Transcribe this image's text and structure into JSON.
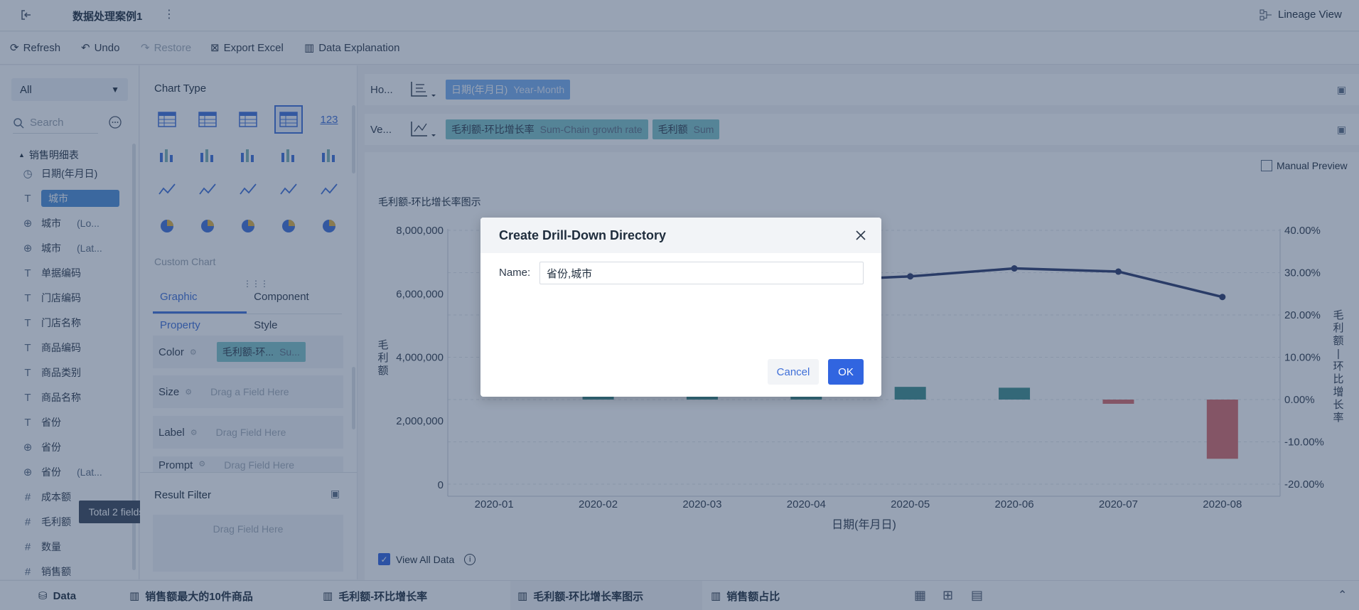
{
  "header": {
    "title": "数据处理案例1",
    "lineage_label": "Lineage View"
  },
  "toolbar": {
    "refresh": "Refresh",
    "undo": "Undo",
    "restore": "Restore",
    "export": "Export Excel",
    "explain": "Data Explanation"
  },
  "fields_panel": {
    "filter_value": "All",
    "search_placeholder": "Search",
    "table_name": "销售明细表",
    "fields": [
      {
        "icon": "clock-icon",
        "label": "日期(年月日)",
        "suffix": ""
      },
      {
        "icon": "text-icon",
        "label": "城市",
        "suffix": ""
      },
      {
        "icon": "globe-icon",
        "label": "城市",
        "suffix": "(Lo..."
      },
      {
        "icon": "globe-icon",
        "label": "城市",
        "suffix": "(Lat..."
      },
      {
        "icon": "text-icon",
        "label": "单据编码",
        "suffix": ""
      },
      {
        "icon": "text-icon",
        "label": "门店编码",
        "suffix": ""
      },
      {
        "icon": "text-icon",
        "label": "门店名称",
        "suffix": ""
      },
      {
        "icon": "text-icon",
        "label": "商品编码",
        "suffix": ""
      },
      {
        "icon": "text-icon",
        "label": "商品类别",
        "suffix": ""
      },
      {
        "icon": "text-icon",
        "label": "商品名称",
        "suffix": ""
      },
      {
        "icon": "text-icon",
        "label": "省份",
        "suffix": ""
      },
      {
        "icon": "globe-icon",
        "label": "省份",
        "suffix": ""
      },
      {
        "icon": "globe-icon",
        "label": "省份",
        "suffix": "(Lat..."
      },
      {
        "icon": "hash-icon",
        "label": "成本额",
        "suffix": ""
      },
      {
        "icon": "hash-icon",
        "label": "毛利额",
        "suffix": ""
      },
      {
        "icon": "hash-icon",
        "label": "数量",
        "suffix": ""
      },
      {
        "icon": "hash-icon",
        "label": "销售额",
        "suffix": ""
      }
    ],
    "tooltip": "Total 2 fields"
  },
  "chart_panel": {
    "chart_type_label": "Chart Type",
    "custom_chart_label": "Custom Chart",
    "tab_graphic": "Graphic Property",
    "tab_component": "Component Style",
    "color_label": "Color",
    "color_chip": "毛利额-环...",
    "color_chip_sub": "Su...",
    "size_label": "Size",
    "size_placeholder": "Drag a Field Here",
    "label_label": "Label",
    "label_placeholder": "Drag Field Here",
    "prompt_label": "Prompt",
    "prompt_placeholder": "Drag Field Here",
    "result_filter": "Result Filter",
    "result_placeholder": "Drag Field Here"
  },
  "axes_bar": {
    "horizontal_label": "Ho...",
    "vertical_label": "Ve...",
    "h_chip": "日期(年月日)",
    "h_chip_sub": "Year-Month",
    "v_chip1": "毛利额-环比增长率",
    "v_chip1_sub": "Sum-Chain growth rate",
    "v_chip2": "毛利额",
    "v_chip2_sub": "Sum",
    "manual_preview": "Manual Preview"
  },
  "chart_data": {
    "type": "bar",
    "title": "毛利额-环比增长率图示",
    "xlabel": "日期(年月日)",
    "ylabel": "毛利额",
    "y2label": "毛利额-环比增长率",
    "categories": [
      "2020-01",
      "2020-02",
      "2020-03",
      "2020-04",
      "2020-05",
      "2020-06",
      "2020-07",
      "2020-08"
    ],
    "yticks": [
      "8,000,000",
      "6,000,000",
      "4,000,000",
      "2,000,000",
      "0"
    ],
    "y2ticks": [
      "40.00%",
      "30.00%",
      "20.00%",
      "10.00%",
      "0.00%",
      "-10.00%",
      "-20.00%"
    ],
    "ylim": [
      0,
      8000000
    ],
    "y2lim": [
      -20,
      40
    ],
    "series": [
      {
        "name": "毛利额-环比增长率",
        "kind": "bar",
        "values": [
          null,
          2.0,
          2.0,
          2.0,
          3.0,
          2.8,
          -1.0,
          -14.0
        ]
      },
      {
        "name": "毛利额",
        "kind": "line",
        "values": [
          null,
          null,
          null,
          6400000,
          6550000,
          6800000,
          6700000,
          5900000
        ]
      }
    ],
    "colors": {
      "positive": "#3f8f8c",
      "negative": "#d86a6a",
      "line": "#2c3a6b"
    }
  },
  "view_all_data": "View All Data",
  "bottom_tabs": {
    "data": "Data",
    "tab1": "销售额最大的10件商品",
    "tab2": "毛利额-环比增长率",
    "tab3": "毛利额-环比增长率图示",
    "tab4": "销售额占比"
  },
  "dialog": {
    "title": "Create Drill-Down Directory",
    "name_label": "Name:",
    "name_value": "省份,城市",
    "cancel": "Cancel",
    "ok": "OK"
  }
}
